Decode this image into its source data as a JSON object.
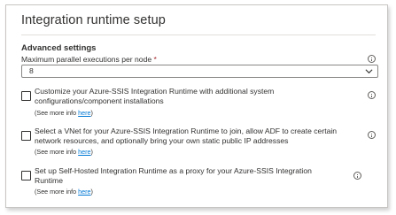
{
  "panel": {
    "title": "Integration runtime setup"
  },
  "advanced": {
    "section_title": "Advanced settings",
    "max_parallel_label": "Maximum parallel executions per node",
    "required_mark": "*",
    "max_parallel_value": "8"
  },
  "options": [
    {
      "line1": "Customize your Azure-SSIS Integration Runtime with additional system",
      "line2": "configurations/component installations",
      "see_more_prefix": "(See more info ",
      "see_more_link": "here",
      "see_more_suffix": ")",
      "checked": false
    },
    {
      "line1": "Select a VNet for your Azure-SSIS Integration Runtime to join, allow ADF to create certain",
      "line2": "network resources, and optionally bring your own static public IP addresses",
      "see_more_prefix": "(See more info ",
      "see_more_link": "here",
      "see_more_suffix": ")",
      "checked": false
    },
    {
      "line1": "Set up Self-Hosted Integration Runtime as a proxy for your Azure-SSIS Integration",
      "line2": "Runtime",
      "see_more_prefix": "(See more info ",
      "see_more_link": "here",
      "see_more_suffix": ")",
      "checked": false
    }
  ],
  "icons": {
    "info": "info-icon",
    "dropdown": "chevron-down-icon"
  },
  "colors": {
    "link": "#0078d4",
    "required": "#a4262c",
    "text": "#323130"
  }
}
